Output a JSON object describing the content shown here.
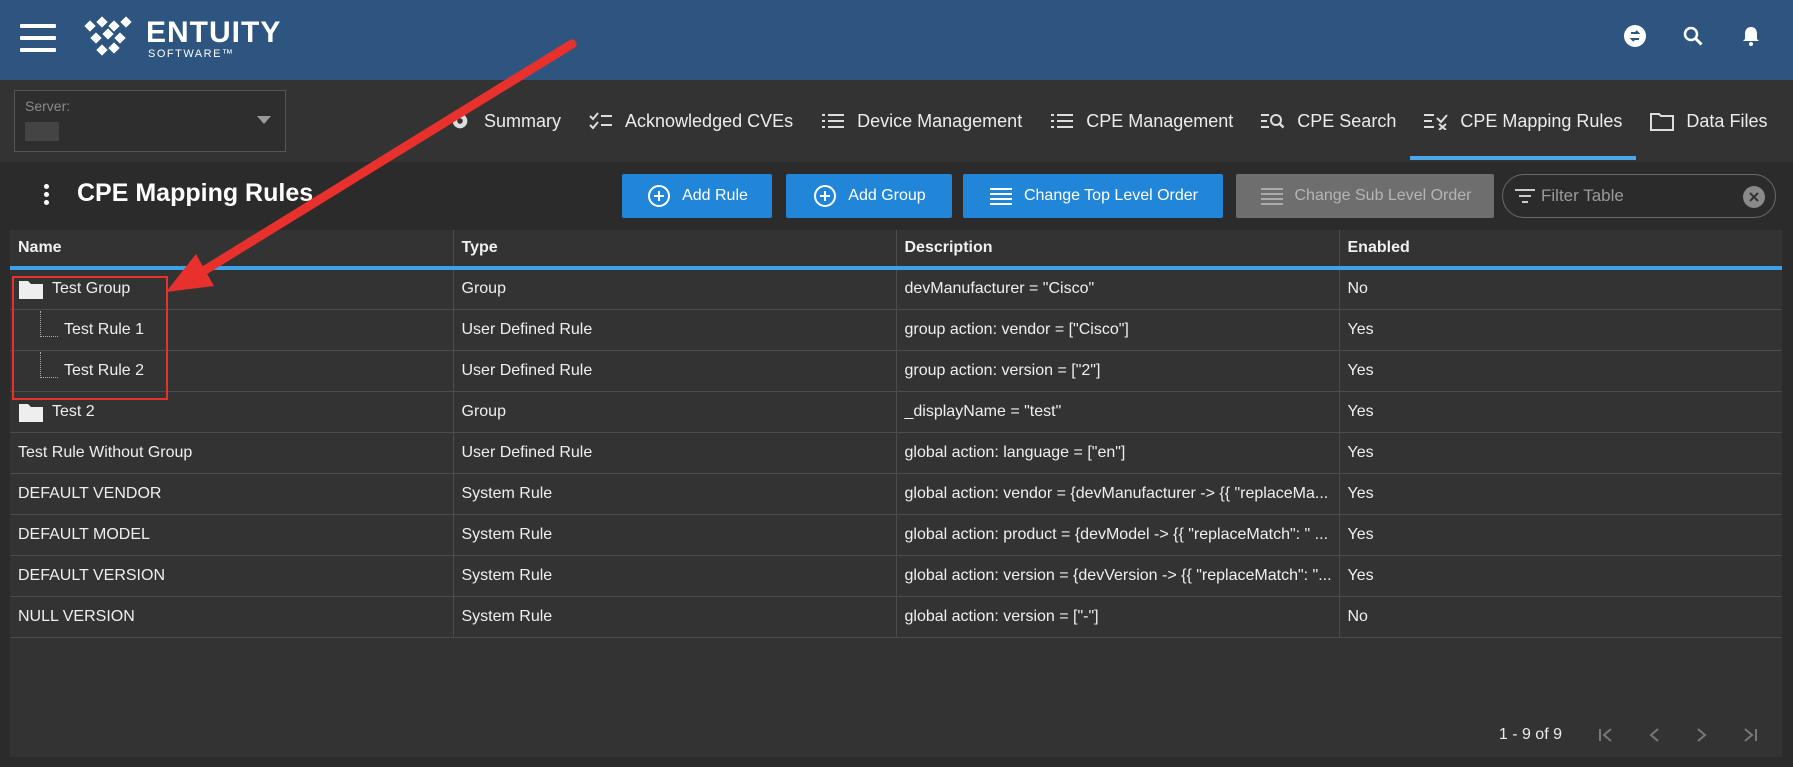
{
  "header": {
    "logo_name": "ENTUITY",
    "logo_sub": "SOFTWARE™"
  },
  "server": {
    "label": "Server:"
  },
  "tabs": [
    {
      "label": "Summary",
      "icon": "gear-icon"
    },
    {
      "label": "Acknowledged CVEs",
      "icon": "checklist-icon"
    },
    {
      "label": "Device Management",
      "icon": "list-icon"
    },
    {
      "label": "CPE Management",
      "icon": "list-icon"
    },
    {
      "label": "CPE Search",
      "icon": "list-search-icon"
    },
    {
      "label": "CPE Mapping Rules",
      "icon": "list-mapping-icon",
      "active": true
    },
    {
      "label": "Data Files",
      "icon": "folder-icon"
    }
  ],
  "toolbar": {
    "title": "CPE Mapping Rules",
    "add_rule": "Add Rule",
    "add_group": "Add Group",
    "change_top": "Change Top Level Order",
    "change_sub": "Change Sub Level Order",
    "filter_placeholder": "Filter Table"
  },
  "table": {
    "columns": [
      "Name",
      "Type",
      "Description",
      "Enabled"
    ],
    "rows": [
      {
        "name": "Test Group",
        "type": "Group",
        "description": "devManufacturer = \"Cisco\"",
        "enabled": "No",
        "kind": "group"
      },
      {
        "name": "Test Rule 1",
        "type": "User Defined Rule",
        "description": "group action: vendor = [\"Cisco\"]",
        "enabled": "Yes",
        "kind": "child"
      },
      {
        "name": "Test Rule 2",
        "type": "User Defined Rule",
        "description": "group action: version = [\"2\"]",
        "enabled": "Yes",
        "kind": "child"
      },
      {
        "name": "Test 2",
        "type": "Group",
        "description": "_displayName = \"test\"",
        "enabled": "Yes",
        "kind": "group"
      },
      {
        "name": "Test Rule Without Group",
        "type": "User Defined Rule",
        "description": "global action: language = [\"en\"]",
        "enabled": "Yes",
        "kind": "plain"
      },
      {
        "name": "DEFAULT VENDOR",
        "type": "System Rule",
        "description": "global action: vendor = {devManufacturer -> {{ \"replaceMa...",
        "enabled": "Yes",
        "kind": "plain"
      },
      {
        "name": "DEFAULT MODEL",
        "type": "System Rule",
        "description": "global action: product = {devModel -> {{ \"replaceMatch\": \" ...",
        "enabled": "Yes",
        "kind": "plain"
      },
      {
        "name": "DEFAULT VERSION",
        "type": "System Rule",
        "description": "global action: version = {devVersion -> {{ \"replaceMatch\": \"...",
        "enabled": "Yes",
        "kind": "plain"
      },
      {
        "name": "NULL VERSION",
        "type": "System Rule",
        "description": "global action: version = [\"-\"]",
        "enabled": "No",
        "kind": "plain"
      }
    ]
  },
  "pager": {
    "text": "1 - 9 of 9"
  },
  "colors": {
    "topbar": "#2d5580",
    "accent": "#2185d8",
    "annotation": "#e8302c"
  }
}
